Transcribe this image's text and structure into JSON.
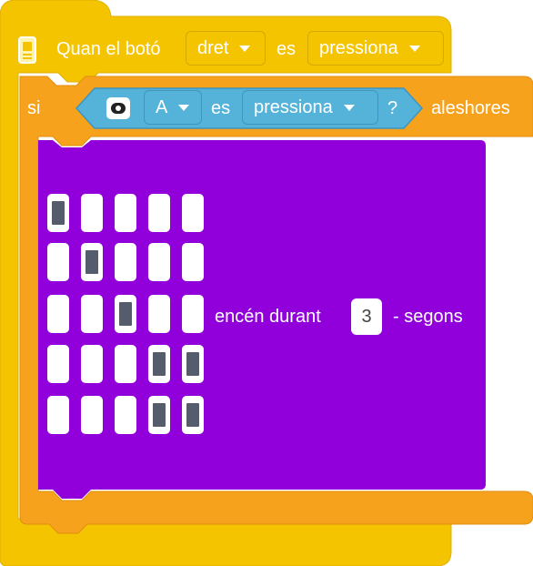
{
  "event_block": {
    "label_prefix": "Quan el botó",
    "button_value": "dret",
    "connector": "es",
    "state_value": "pressiona"
  },
  "if_block": {
    "label_if": "si",
    "label_then": "aleshores",
    "condition": {
      "button_value": "A",
      "connector": "es",
      "state_value": "pressiona",
      "question": "?"
    }
  },
  "display_block": {
    "led_grid": [
      [
        1,
        0,
        0,
        0,
        0
      ],
      [
        0,
        1,
        0,
        0,
        0
      ],
      [
        0,
        0,
        1,
        0,
        0
      ],
      [
        0,
        0,
        0,
        1,
        1
      ],
      [
        0,
        0,
        0,
        1,
        1
      ]
    ],
    "label_prefix": "encén durant",
    "duration": "3",
    "label_suffix": "- segons"
  },
  "colors": {
    "event": "#f5c400",
    "control": "#f6a21c",
    "sensor": "#55b3da",
    "display": "#9100db"
  },
  "icons": {
    "hub": "hub-icon",
    "button_sensor": "button-sensor-icon"
  }
}
